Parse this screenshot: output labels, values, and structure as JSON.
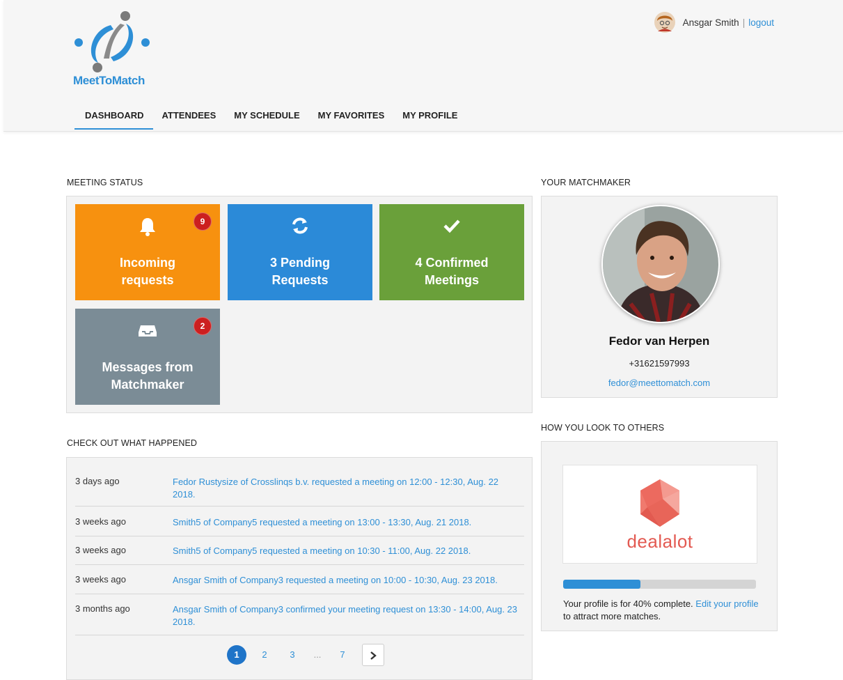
{
  "brand": {
    "name": "MeetToMatch"
  },
  "user": {
    "name": "Ansgar Smith",
    "separator": "|",
    "logout_label": "logout"
  },
  "nav": {
    "items": [
      {
        "label": "DASHBOARD",
        "active": true
      },
      {
        "label": "ATTENDEES"
      },
      {
        "label": "MY SCHEDULE"
      },
      {
        "label": "MY FAVORITES"
      },
      {
        "label": "MY PROFILE"
      }
    ]
  },
  "meeting_status": {
    "title": "MEETING STATUS",
    "tiles": [
      {
        "label": "Incoming\nrequests",
        "badge": "9",
        "color": "#f7910f",
        "icon": "bell-icon"
      },
      {
        "label": "3 Pending\nRequests",
        "color": "#2b8ad8",
        "icon": "refresh-icon"
      },
      {
        "label": "4 Confirmed\nMeetings",
        "color": "#6aa03a",
        "icon": "check-icon"
      },
      {
        "label": "Messages from\nMatchmaker",
        "badge": "2",
        "color": "#7b8c96",
        "icon": "inbox-icon"
      }
    ]
  },
  "activity": {
    "title": "CHECK OUT WHAT HAPPENED",
    "rows": [
      {
        "when": "3 days ago",
        "what": "Fedor Rustysize of Crosslinqs b.v. requested a meeting on 12:00 - 12:30, Aug. 22 2018."
      },
      {
        "when": "3 weeks ago",
        "what": "Smith5 of Company5 requested a meeting on 13:00 - 13:30, Aug. 21 2018."
      },
      {
        "when": "3 weeks ago",
        "what": "Smith5 of Company5 requested a meeting on 10:30 - 11:00, Aug. 22 2018."
      },
      {
        "when": "3 weeks ago",
        "what": "Ansgar Smith of Company3 requested a meeting on 10:00 - 10:30, Aug. 23 2018."
      },
      {
        "when": "3 months ago",
        "what": "Ansgar Smith of Company3 confirmed your meeting request on 13:30 - 14:00, Aug. 23 2018."
      }
    ],
    "pagination": {
      "pages": [
        "1",
        "2",
        "3",
        "...",
        "7"
      ],
      "current": "1",
      "next_icon": "chevron-right-icon"
    }
  },
  "matchmaker": {
    "title": "YOUR MATCHMAKER",
    "name": "Fedor van Herpen",
    "phone": "+31621597993",
    "email": "fedor@meettomatch.com"
  },
  "profile": {
    "title": "HOW YOU LOOK TO OTHERS",
    "company": "dealalot",
    "completion": 0.4,
    "text_before": "Your profile is for 40% complete. ",
    "edit_link": "Edit your profile",
    "text_after": " to attract more matches."
  },
  "colors": {
    "accent": "#2e8fd6",
    "badge": "#cc1f1f"
  }
}
